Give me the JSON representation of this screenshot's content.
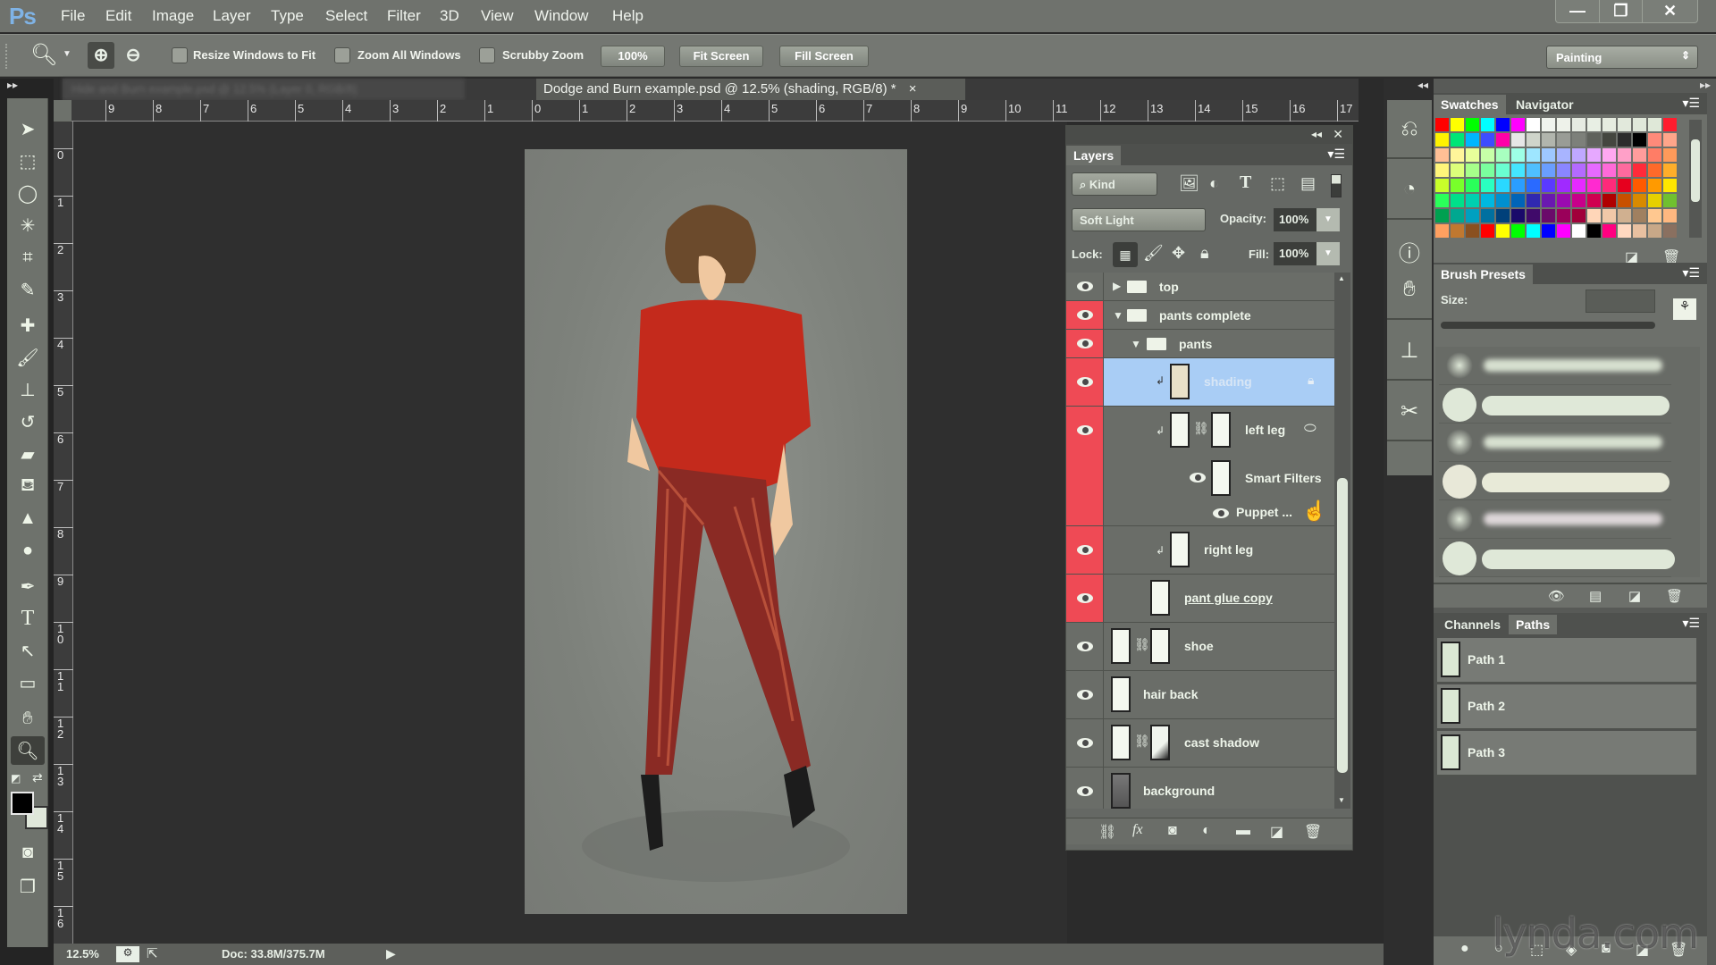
{
  "app": {
    "logo": "Ps"
  },
  "menu": [
    "File",
    "Edit",
    "Image",
    "Layer",
    "Type",
    "Select",
    "Filter",
    "3D",
    "View",
    "Window",
    "Help"
  ],
  "window_controls": {
    "minimize": "—",
    "restore": "❐",
    "close": "✕"
  },
  "options_bar": {
    "resize_windows_label": "Resize Windows to Fit",
    "zoom_all_label": "Zoom All Windows",
    "scrubby_zoom_label": "Scrubby Zoom",
    "btn_100": "100%",
    "btn_fit": "Fit Screen",
    "btn_fill": "Fill Screen",
    "workspace": "Painting"
  },
  "tabs": {
    "inactive": "Hide and Burn example.psd @ 12.5% (Layer 0, RGB/8)",
    "active": "Dodge and Burn example.psd @ 12.5% (shading, RGB/8) *",
    "close": "×"
  },
  "ruler": {
    "h_ticks": [
      "9",
      "8",
      "7",
      "6",
      "5",
      "4",
      "3",
      "2",
      "1",
      "0",
      "1",
      "2",
      "3",
      "4",
      "5",
      "6",
      "7",
      "8",
      "9",
      "10",
      "11",
      "12",
      "13",
      "14",
      "15",
      "16",
      "17"
    ],
    "v_ticks": [
      "0",
      "1",
      "2",
      "3",
      "4",
      "5",
      "6",
      "7",
      "8",
      "9",
      "10",
      "11",
      "12",
      "13",
      "14",
      "15",
      "16"
    ]
  },
  "status": {
    "zoom": "12.5%",
    "doc": "Doc: 33.8M/375.7M"
  },
  "layers": {
    "title": "Layers",
    "filter_kind": "Kind",
    "blend_mode": "Soft Light",
    "opacity_label": "Opacity:",
    "opacity": "100%",
    "lock_label": "Lock:",
    "fill_label": "Fill:",
    "fill": "100%",
    "items": [
      {
        "name": "top",
        "type": "group-collapsed",
        "red": false
      },
      {
        "name": "pants complete",
        "type": "group-open",
        "red": true
      },
      {
        "name": "pants",
        "type": "group-open",
        "red": true
      },
      {
        "name": "shading",
        "type": "layer",
        "red": true,
        "selected": true
      },
      {
        "name": "left leg",
        "type": "smart",
        "red": true
      },
      {
        "name": "Smart Filters",
        "type": "filter"
      },
      {
        "name": "Puppet ...",
        "type": "filter-item"
      },
      {
        "name": "right leg",
        "type": "smart",
        "red": true
      },
      {
        "name": "pant glue copy",
        "type": "layer",
        "red": true
      },
      {
        "name": "shoe",
        "type": "masked",
        "red": false
      },
      {
        "name": "hair back",
        "type": "layer",
        "red": false
      },
      {
        "name": "cast shadow",
        "type": "masked",
        "red": false
      },
      {
        "name": "background",
        "type": "layer",
        "red": false
      }
    ]
  },
  "swatches": {
    "tabs": [
      "Swatches",
      "Navigator"
    ],
    "colors": [
      [
        "#ff0000",
        "#ffff00",
        "#00ff00",
        "#00ffff",
        "#0000ff",
        "#ff00ff",
        "#ffffff",
        "#f0f4ee",
        "#eef2ea",
        "#e6ebe2",
        "#e8efe4",
        "#e6ece0",
        "#e2e9dc",
        "#e0e8da",
        "#dfe8d8",
        "#ff1c2e"
      ],
      [
        "#fff200",
        "#00e676",
        "#00b6ff",
        "#3d4dff",
        "#ff00a8",
        "#e6e6e6",
        "#cfd4ca",
        "#b1b5ad",
        "#999c96",
        "#7d807a",
        "#5f625c",
        "#44463f",
        "#2c2c2c",
        "#000000",
        "#ff8a7a",
        "#ffa58a"
      ],
      [
        "#ffbf95",
        "#fff59a",
        "#e8ff9a",
        "#c7ffa8",
        "#a8ffbf",
        "#9effe6",
        "#9ee6ff",
        "#9ec8ff",
        "#a8b4ff",
        "#bfa8ff",
        "#e6a8ff",
        "#ffa8f0",
        "#ffa0c8",
        "#ff9c9c",
        "#ff7d66",
        "#ff9a5a"
      ],
      [
        "#fff57a",
        "#dcff7a",
        "#a6ff8a",
        "#7aff9e",
        "#6affd1",
        "#44e6ff",
        "#4fbfff",
        "#6a9eff",
        "#8a86ff",
        "#b46aff",
        "#e66aff",
        "#ff6ad8",
        "#ff6a9e",
        "#ff2a3a",
        "#ff6a2a",
        "#ffae2a"
      ],
      [
        "#c8ff2a",
        "#78ff2a",
        "#2aff5a",
        "#2affc0",
        "#2ad8ff",
        "#2a9eff",
        "#2a6aff",
        "#5a3aff",
        "#a02aff",
        "#e62aff",
        "#ff2ad0",
        "#ff2a7a",
        "#e6001e",
        "#ff5a00",
        "#ff9a00",
        "#ffe600"
      ],
      [
        "#2aff5a",
        "#00e08a",
        "#00d0b0",
        "#00b8e0",
        "#0090d0",
        "#0064b8",
        "#3028b0",
        "#6a18b0",
        "#9a0ab0",
        "#c8008a",
        "#d00050",
        "#b00000",
        "#c85000",
        "#d88a00",
        "#e6d000",
        "#70c030"
      ],
      [
        "#00a050",
        "#00a890",
        "#00a0c0",
        "#0070a0",
        "#00407a",
        "#1a0a6a",
        "#400a6a",
        "#6a0a6a",
        "#9a005a",
        "#a0003a",
        "#ffd6b8",
        "#f0c8a8",
        "#d0b090",
        "#a08060",
        "#ffc890",
        "#ffb880"
      ],
      [
        "#ffa060",
        "#c07830",
        "#8a5020",
        "#ff0000",
        "#ffff00",
        "#00ff00",
        "#00ffff",
        "#0000ff",
        "#ff00ff",
        "#ffffff",
        "#000000",
        "#ff0080",
        "#ffd8c0",
        "#e8c0a0",
        "#c8a888",
        "#8a7060"
      ]
    ]
  },
  "brush_presets": {
    "title": "Brush Presets",
    "size_label": "Size:"
  },
  "paths": {
    "tabs": [
      "Channels",
      "Paths"
    ],
    "items": [
      "Path 1",
      "Path 2",
      "Path 3"
    ]
  },
  "watermark": "lynda.com"
}
